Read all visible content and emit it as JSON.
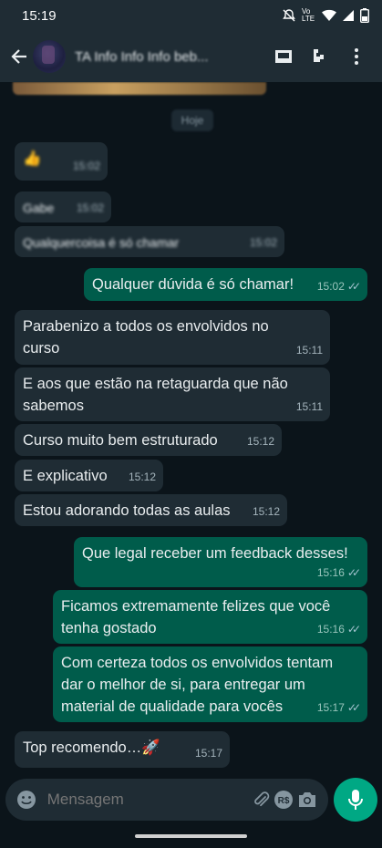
{
  "status": {
    "time": "15:19",
    "network": "Vo LTE"
  },
  "header": {
    "contact_name": "TA Info Info Info beb..."
  },
  "chat": {
    "date_chip": "Hoje",
    "messages": [
      {
        "dir": "in",
        "text": "👍",
        "time": "15:02",
        "blurred": true
      },
      {
        "dir": "in",
        "text": "Gabe",
        "time": "15:02",
        "blurred": true
      },
      {
        "dir": "in",
        "text": "Qualquercoisa é só chamar",
        "time": "15:02",
        "blurred": true
      },
      {
        "dir": "out",
        "text": "Qualquer dúvida é só chamar!",
        "time": "15:02",
        "read": true
      },
      {
        "dir": "in",
        "text": "Parabenizo a todos os envolvidos no curso",
        "time": "15:11"
      },
      {
        "dir": "in",
        "text": "E aos que estão na retaguarda que não sabemos",
        "time": "15:11"
      },
      {
        "dir": "in",
        "text": "Curso muito bem estruturado",
        "time": "15:12"
      },
      {
        "dir": "in",
        "text": "E explicativo",
        "time": "15:12"
      },
      {
        "dir": "in",
        "text": "Estou adorando todas as aulas",
        "time": "15:12"
      },
      {
        "dir": "out",
        "text": "Que legal receber um feedback desses!",
        "time": "15:16",
        "read": true
      },
      {
        "dir": "out",
        "text": "Ficamos extremamente felizes que você tenha gostado",
        "time": "15:16",
        "read": true
      },
      {
        "dir": "out",
        "text": "Com certeza todos os envolvidos tentam dar o melhor de si, para entregar um material de qualidade para vocês",
        "time": "15:17",
        "read": true
      },
      {
        "dir": "in",
        "text": "Top recomendo…🚀",
        "time": "15:17"
      }
    ]
  },
  "composer": {
    "placeholder": "Mensagem"
  },
  "colors": {
    "header": "#1f2c34",
    "background": "#0b141a",
    "incoming": "#1f2c34",
    "outgoing": "#005c4b",
    "accent": "#00a884"
  },
  "icons": [
    "back-arrow-icon",
    "avatar",
    "video-call-icon",
    "phone-call-icon",
    "more-icon",
    "emoji-icon",
    "attach-icon",
    "payment-icon",
    "camera-icon",
    "mic-icon"
  ]
}
